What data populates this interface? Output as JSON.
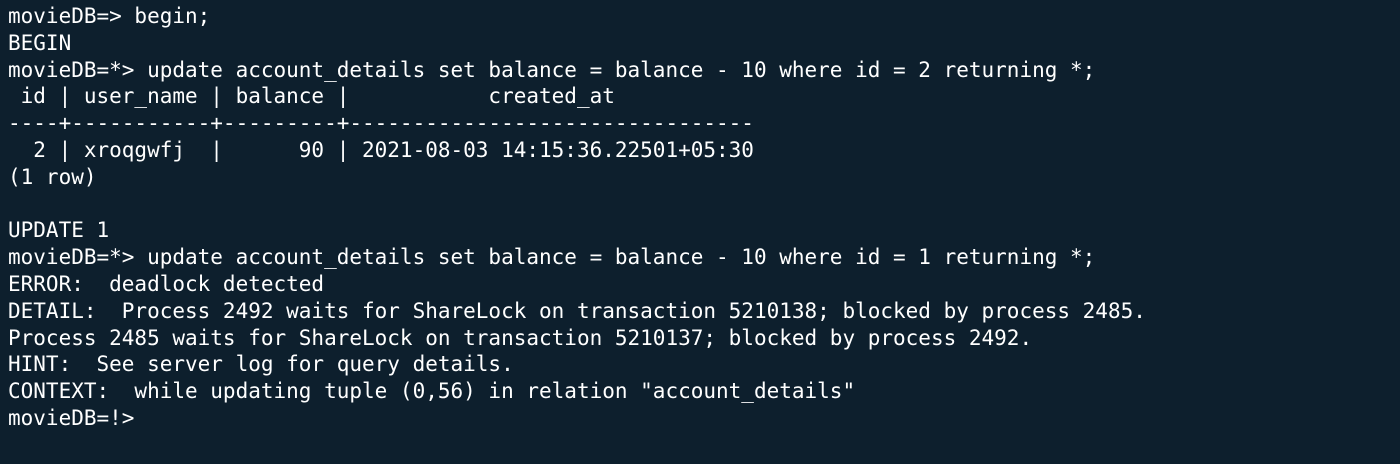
{
  "terminal": {
    "lines": [
      "movieDB=> begin;",
      "BEGIN",
      "movieDB=*> update account_details set balance = balance - 10 where id = 2 returning *;",
      " id | user_name | balance |           created_at",
      "----+-----------+---------+--------------------------------",
      "  2 | xroqgwfj  |      90 | 2021-08-03 14:15:36.22501+05:30",
      "(1 row)",
      "",
      "UPDATE 1",
      "movieDB=*> update account_details set balance = balance - 10 where id = 1 returning *;",
      "ERROR:  deadlock detected",
      "DETAIL:  Process 2492 waits for ShareLock on transaction 5210138; blocked by process 2485.",
      "Process 2485 waits for ShareLock on transaction 5210137; blocked by process 2492.",
      "HINT:  See server log for query details.",
      "CONTEXT:  while updating tuple (0,56) in relation \"account_details\"",
      "movieDB=!>"
    ]
  }
}
